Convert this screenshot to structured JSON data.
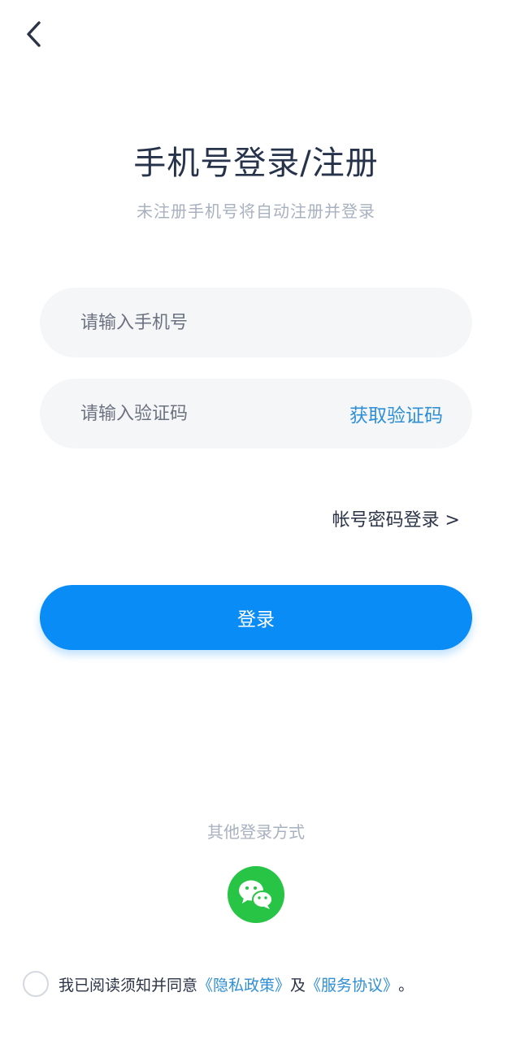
{
  "header": {
    "back_icon": "chevron-left-icon"
  },
  "title": "手机号登录/注册",
  "subtitle": "未注册手机号将自动注册并登录",
  "form": {
    "phone_placeholder": "请输入手机号",
    "code_placeholder": "请输入验证码",
    "get_code_label": "获取验证码"
  },
  "password_login_label": "帐号密码登录 >",
  "login_button_label": "登录",
  "other_login": {
    "title": "其他登录方式",
    "wechat_icon": "wechat-icon"
  },
  "agreement": {
    "prefix": "我已阅读须知并同意",
    "privacy_link": "《隐私政策》",
    "joiner": "及",
    "service_link": "《服务协议》",
    "suffix": "。"
  },
  "colors": {
    "accent": "#0a8cf6",
    "link": "#2e8fd6",
    "wechat": "#28c445"
  }
}
